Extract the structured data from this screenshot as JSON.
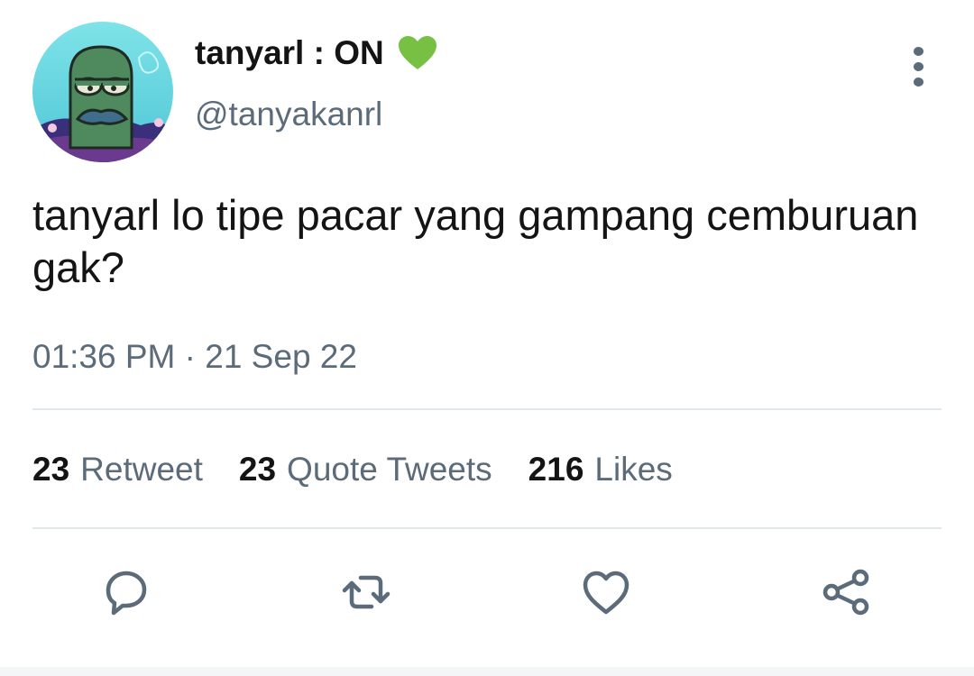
{
  "colors": {
    "text_primary": "#141414",
    "text_secondary": "#5b6b7a",
    "divider": "#e1e8ed",
    "heart_emoji": "#77c043"
  },
  "user": {
    "display_name": "tanyarl : ON",
    "status_emoji": "green-heart-icon",
    "handle": "@tanyakanrl"
  },
  "tweet": {
    "text": "tanyarl lo tipe pacar yang gampang cemburuan gak?",
    "timestamp": "01:36 PM · 21 Sep 22"
  },
  "stats": {
    "retweets": {
      "count": "23",
      "label": "Retweet"
    },
    "quotes": {
      "count": "23",
      "label": "Quote Tweets"
    },
    "likes": {
      "count": "216",
      "label": "Likes"
    }
  },
  "actions": [
    "reply-icon",
    "retweet-icon",
    "like-icon",
    "share-icon"
  ]
}
